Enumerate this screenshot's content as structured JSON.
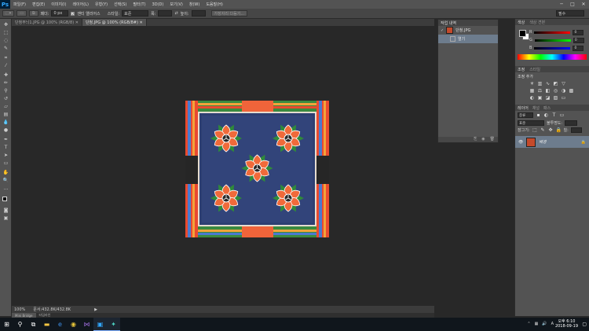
{
  "app": {
    "logo": "Ps"
  },
  "menu": [
    "파일(F)",
    "편집(E)",
    "이미지(I)",
    "레이어(L)",
    "유형(Y)",
    "선택(S)",
    "필터(T)",
    "3D(D)",
    "보기(V)",
    "창(W)",
    "도움말(H)"
  ],
  "window_controls": {
    "minimize": "─",
    "maximize": "□",
    "close": "✕"
  },
  "options": {
    "feather_label": "페더:",
    "feather_value": "0 px",
    "antialias_label": "앤티 앨리어스",
    "style_label": "스타일:",
    "style_value": "표준",
    "width_label": "폭:",
    "height_label": "높이:",
    "refine_button": "가장자리 다듬기...",
    "workspace": "필수"
  },
  "tabs": [
    {
      "label": "단청무늬1.JPG @ 100% (RGB/8) ✕",
      "active": false
    },
    {
      "label": "단청.JPG @ 100% (RGB/8#) ✕",
      "active": true
    }
  ],
  "status": {
    "zoom": "100%",
    "doc": "문서:432.8K/432.8K",
    "arrow": "▶"
  },
  "minibridge": [
    "Mini Bridge",
    "타임라인"
  ],
  "history": {
    "title": "작업 내역",
    "snapshot": "단청.JPG",
    "step": "열기"
  },
  "color_panel": {
    "tabs": [
      "색상",
      "색상 견본"
    ],
    "rows": [
      {
        "label": "R",
        "value": "0"
      },
      {
        "label": "G",
        "value": "0"
      },
      {
        "label": "B",
        "value": "0"
      }
    ]
  },
  "adjust_panel": {
    "tabs": [
      "조정",
      "스타일"
    ],
    "title": "조정 추가"
  },
  "layers_panel": {
    "tabs": [
      "레이어",
      "채널",
      "패스"
    ],
    "kind": "종류",
    "blend": "표준",
    "opacity_label": "불투명도:",
    "lock_label": "잠그기:",
    "fill_label": "칠:",
    "layer_name": "배경"
  },
  "taskbar": {
    "time": "오후 6:10",
    "date": "2018-09-19"
  },
  "colors": {
    "accent": "#31a8ff",
    "selection": "#6d7c8d"
  }
}
